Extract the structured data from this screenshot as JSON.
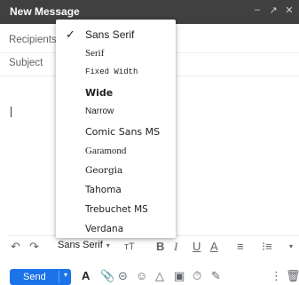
{
  "window": {
    "title": "New Message",
    "controls": [
      "–",
      "↗",
      "✕"
    ]
  },
  "fields": {
    "recipients": "Recipients",
    "subject": "Subject"
  },
  "font_menu": {
    "selected": "Sans Serif",
    "items": [
      {
        "label": "Sans Serif",
        "font": "\"Liberation Sans\", sans-serif",
        "size": "12px",
        "weight": "normal"
      },
      {
        "label": "Serif",
        "font": "\"Liberation Serif\", serif",
        "size": "11px",
        "weight": "normal"
      },
      {
        "label": "Fixed Width",
        "font": "\"Liberation Mono\", monospace",
        "size": "9px",
        "weight": "normal"
      },
      {
        "label": "Wide",
        "font": "\"DejaVu Sans\", sans-serif",
        "size": "11px",
        "weight": "bold"
      },
      {
        "label": "Narrow",
        "font": "\"Liberation Sans\", sans-serif",
        "size": "10px",
        "weight": "normal"
      },
      {
        "label": "Comic Sans MS",
        "font": "\"DejaVu Sans\", sans-serif",
        "size": "11px",
        "weight": "normal"
      },
      {
        "label": "Garamond",
        "font": "\"Liberation Serif\", serif",
        "size": "11px",
        "weight": "normal"
      },
      {
        "label": "Georgia",
        "font": "\"DejaVu Serif\", serif",
        "size": "10.5px",
        "weight": "normal"
      },
      {
        "label": "Tahoma",
        "font": "\"DejaVu Sans\", sans-serif",
        "size": "10.5px",
        "weight": "normal"
      },
      {
        "label": "Trebuchet MS",
        "font": "\"DejaVu Sans\", sans-serif",
        "size": "10.5px",
        "weight": "normal"
      },
      {
        "label": "Verdana",
        "font": "\"DejaVu Sans\", sans-serif",
        "size": "10.5px",
        "weight": "normal"
      }
    ]
  },
  "format_toolbar": {
    "undo_icon": "↶",
    "redo_icon": "↷",
    "font_name": "Sans Serif",
    "caret": "▾",
    "size_icon": "тT",
    "bold": "B",
    "italic": "I",
    "underline": "U",
    "text_color": "A",
    "align": "≡",
    "list": "⁝≡"
  },
  "action_bar": {
    "send_label": "Send",
    "send_caret": "▾",
    "format_icon": "A",
    "attach_icon": "📎",
    "link_icon": "⊝",
    "emoji_icon": "☺",
    "drive_icon": "△",
    "photo_icon": "▣",
    "lock_icon": "⏱",
    "signature_icon": "✎",
    "more_icon": "⋮",
    "trash_icon": "🗑"
  },
  "colors": {
    "titlebar": "#404040",
    "send": "#1a73e8"
  }
}
